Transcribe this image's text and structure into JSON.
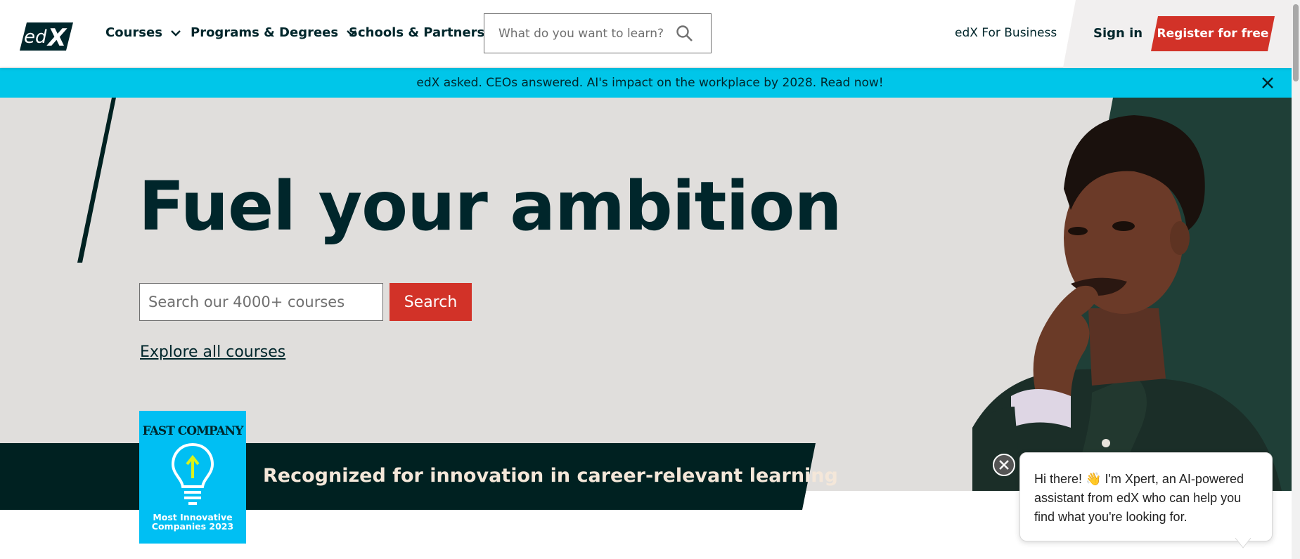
{
  "header": {
    "logo_text": "edX",
    "nav": [
      {
        "label": "Courses"
      },
      {
        "label": "Programs & Degrees"
      },
      {
        "label": "Schools & Partners"
      }
    ],
    "search_placeholder": "What do you want to learn?",
    "business_link": "edX For Business",
    "sign_in": "Sign in",
    "register": "Register for free"
  },
  "announcement": {
    "text": "edX asked. CEOs answered. AI's impact on the workplace by 2028. Read now!"
  },
  "hero": {
    "title": "Fuel your ambition",
    "search_placeholder": "Search our 4000+ courses",
    "search_button": "Search",
    "explore_link": "Explore all courses"
  },
  "recognition": {
    "text": "Recognized for innovation in career-relevant learning",
    "badge_publisher": "FAST COMPANY",
    "badge_line1": "Most Innovative",
    "badge_line2": "Companies 2023"
  },
  "chat": {
    "message": "Hi there! 👋 I'm Xpert, an AI-powered assistant from edX who can help you find what you're looking for."
  },
  "colors": {
    "brand_dark": "#00262b",
    "accent_red": "#d23228",
    "banner_cyan": "#00c6e9",
    "hero_bg": "#e0dedc",
    "badge_blue": "#00bff3"
  }
}
